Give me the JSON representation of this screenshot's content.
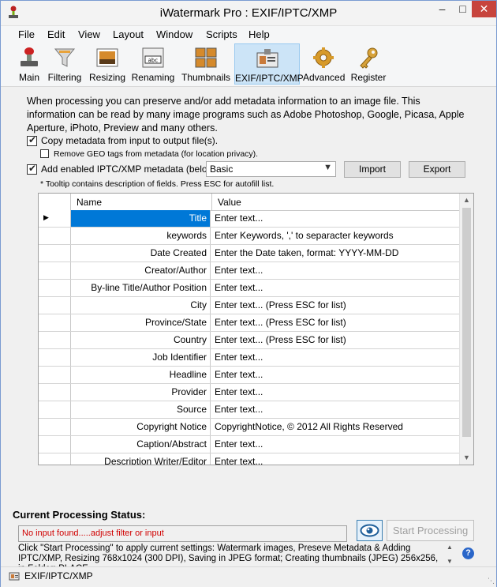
{
  "window": {
    "title": "iWatermark Pro : EXIF/IPTC/XMP"
  },
  "menu": [
    "File",
    "Edit",
    "View",
    "Layout",
    "Window",
    "Scripts",
    "Help"
  ],
  "toolbar": [
    {
      "label": "Main",
      "icon": "stamp-icon"
    },
    {
      "label": "Filtering",
      "icon": "funnel-icon"
    },
    {
      "label": "Resizing",
      "icon": "resize-icon"
    },
    {
      "label": "Renaming",
      "icon": "rename-icon"
    },
    {
      "label": "Thumbnails",
      "icon": "thumbnails-icon"
    },
    {
      "label": "EXIF/IPTC/XMP",
      "icon": "id-card-icon",
      "active": true
    },
    {
      "label": "Advanced",
      "icon": "gear-icon"
    },
    {
      "label": "Register",
      "icon": "key-icon"
    }
  ],
  "panel": {
    "description": "When processing you can preserve and/or add metadata information to an image file. This information can be read by many image programs such as Adobe Photoshop, Google, Picasa, Apple Aperture, iPhoto, Preview and many others.",
    "copy_metadata_label": "Copy metadata from input to output file(s).",
    "remove_geo_label": "Remove GEO tags from metadata (for location privacy).",
    "add_iptc_label": "Add enabled IPTC/XMP metadata (below).",
    "preset_value": "Basic",
    "import_label": "Import",
    "export_label": "Export",
    "tooltip_note": "* Tooltip contains description of fields. Press ESC for autofill list."
  },
  "grid": {
    "headers": {
      "name": "Name",
      "value": "Value"
    },
    "rows": [
      {
        "name": "Title",
        "value": "Enter text..."
      },
      {
        "name": "keywords",
        "value": "Enter Keywords, ',' to separacter keywords"
      },
      {
        "name": "Date Created",
        "value": "Enter the Date taken, format: YYYY-MM-DD"
      },
      {
        "name": "Creator/Author",
        "value": "Enter text..."
      },
      {
        "name": "By-line Title/Author Position",
        "value": "Enter text..."
      },
      {
        "name": "City",
        "value": "Enter text... (Press ESC for list)"
      },
      {
        "name": "Province/State",
        "value": "Enter text... (Press ESC for list)"
      },
      {
        "name": "Country",
        "value": "Enter text... (Press ESC for list)"
      },
      {
        "name": "Job Identifier",
        "value": "Enter text..."
      },
      {
        "name": "Headline",
        "value": "Enter text..."
      },
      {
        "name": "Provider",
        "value": "Enter text..."
      },
      {
        "name": "Source",
        "value": "Enter text..."
      },
      {
        "name": "Copyright Notice",
        "value": "CopyrightNotice, © 2012 All Rights Reserved"
      },
      {
        "name": "Caption/Abstract",
        "value": "Enter text..."
      },
      {
        "name": "Description Writer/Editor",
        "value": "Enter text..."
      }
    ]
  },
  "status": {
    "title": "Current Processing Status:",
    "message": "No input found.....adjust filter or input",
    "start_label": "Start Processing",
    "info": "Click \"Start Processing\" to apply current settings: Watermark images, Preseve Metadata & Adding IPTC/XMP, Resizing 768x1024 (300 DPI), Saving in JPEG format; Creating thumbnails (JPEG) 256x256, in Folder: PLACE",
    "statusbar_text": "EXIF/IPTC/XMP"
  }
}
